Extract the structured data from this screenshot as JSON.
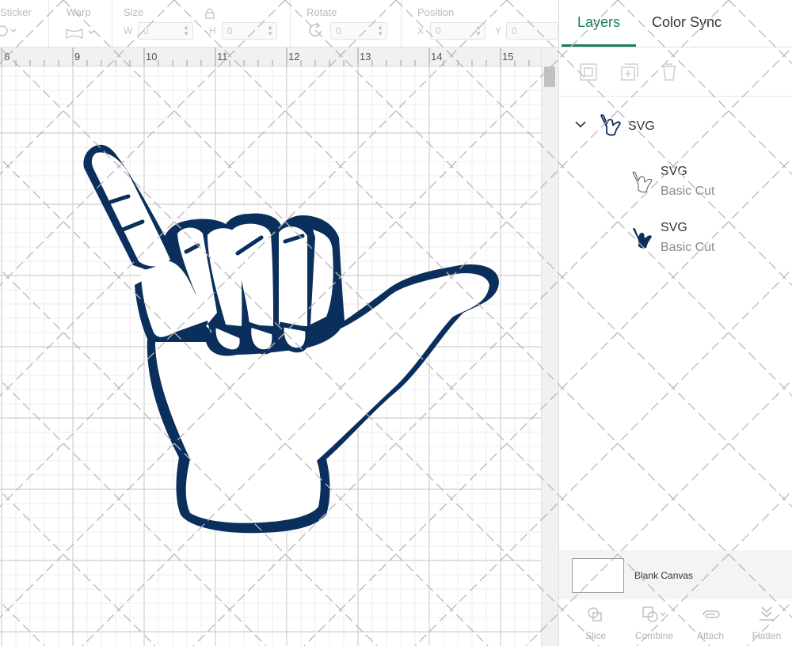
{
  "toolbar": {
    "sticker_label": "Sticker",
    "warp_label": "Warp",
    "size_label": "Size",
    "size_w_letter": "W",
    "size_w_value": "0",
    "size_h_letter": "H",
    "size_h_value": "0",
    "rotate_label": "Rotate",
    "rotate_value": "0",
    "position_label": "Position",
    "pos_x_letter": "X",
    "pos_x_value": "0",
    "pos_y_letter": "Y",
    "pos_y_value": "0"
  },
  "ruler": {
    "ticks": [
      "8",
      "9",
      "10",
      "11",
      "12",
      "13",
      "14",
      "15"
    ]
  },
  "panel": {
    "tabs": [
      {
        "label": "Layers",
        "active": true
      },
      {
        "label": "Color Sync",
        "active": false
      }
    ],
    "layers": {
      "group_name": "SVG",
      "items": [
        {
          "title": "SVG",
          "subtitle": "Basic Cut",
          "color": "#ffffff"
        },
        {
          "title": "SVG",
          "subtitle": "Basic Cut",
          "color": "#0a2f5c"
        }
      ]
    },
    "blank_canvas_label": "Blank Canvas",
    "bottom_actions": [
      "Slice",
      "Combine",
      "Attach",
      "Flatten"
    ]
  },
  "colors": {
    "accent": "#1a7c5a",
    "design_navy": "#0a2f5c"
  }
}
